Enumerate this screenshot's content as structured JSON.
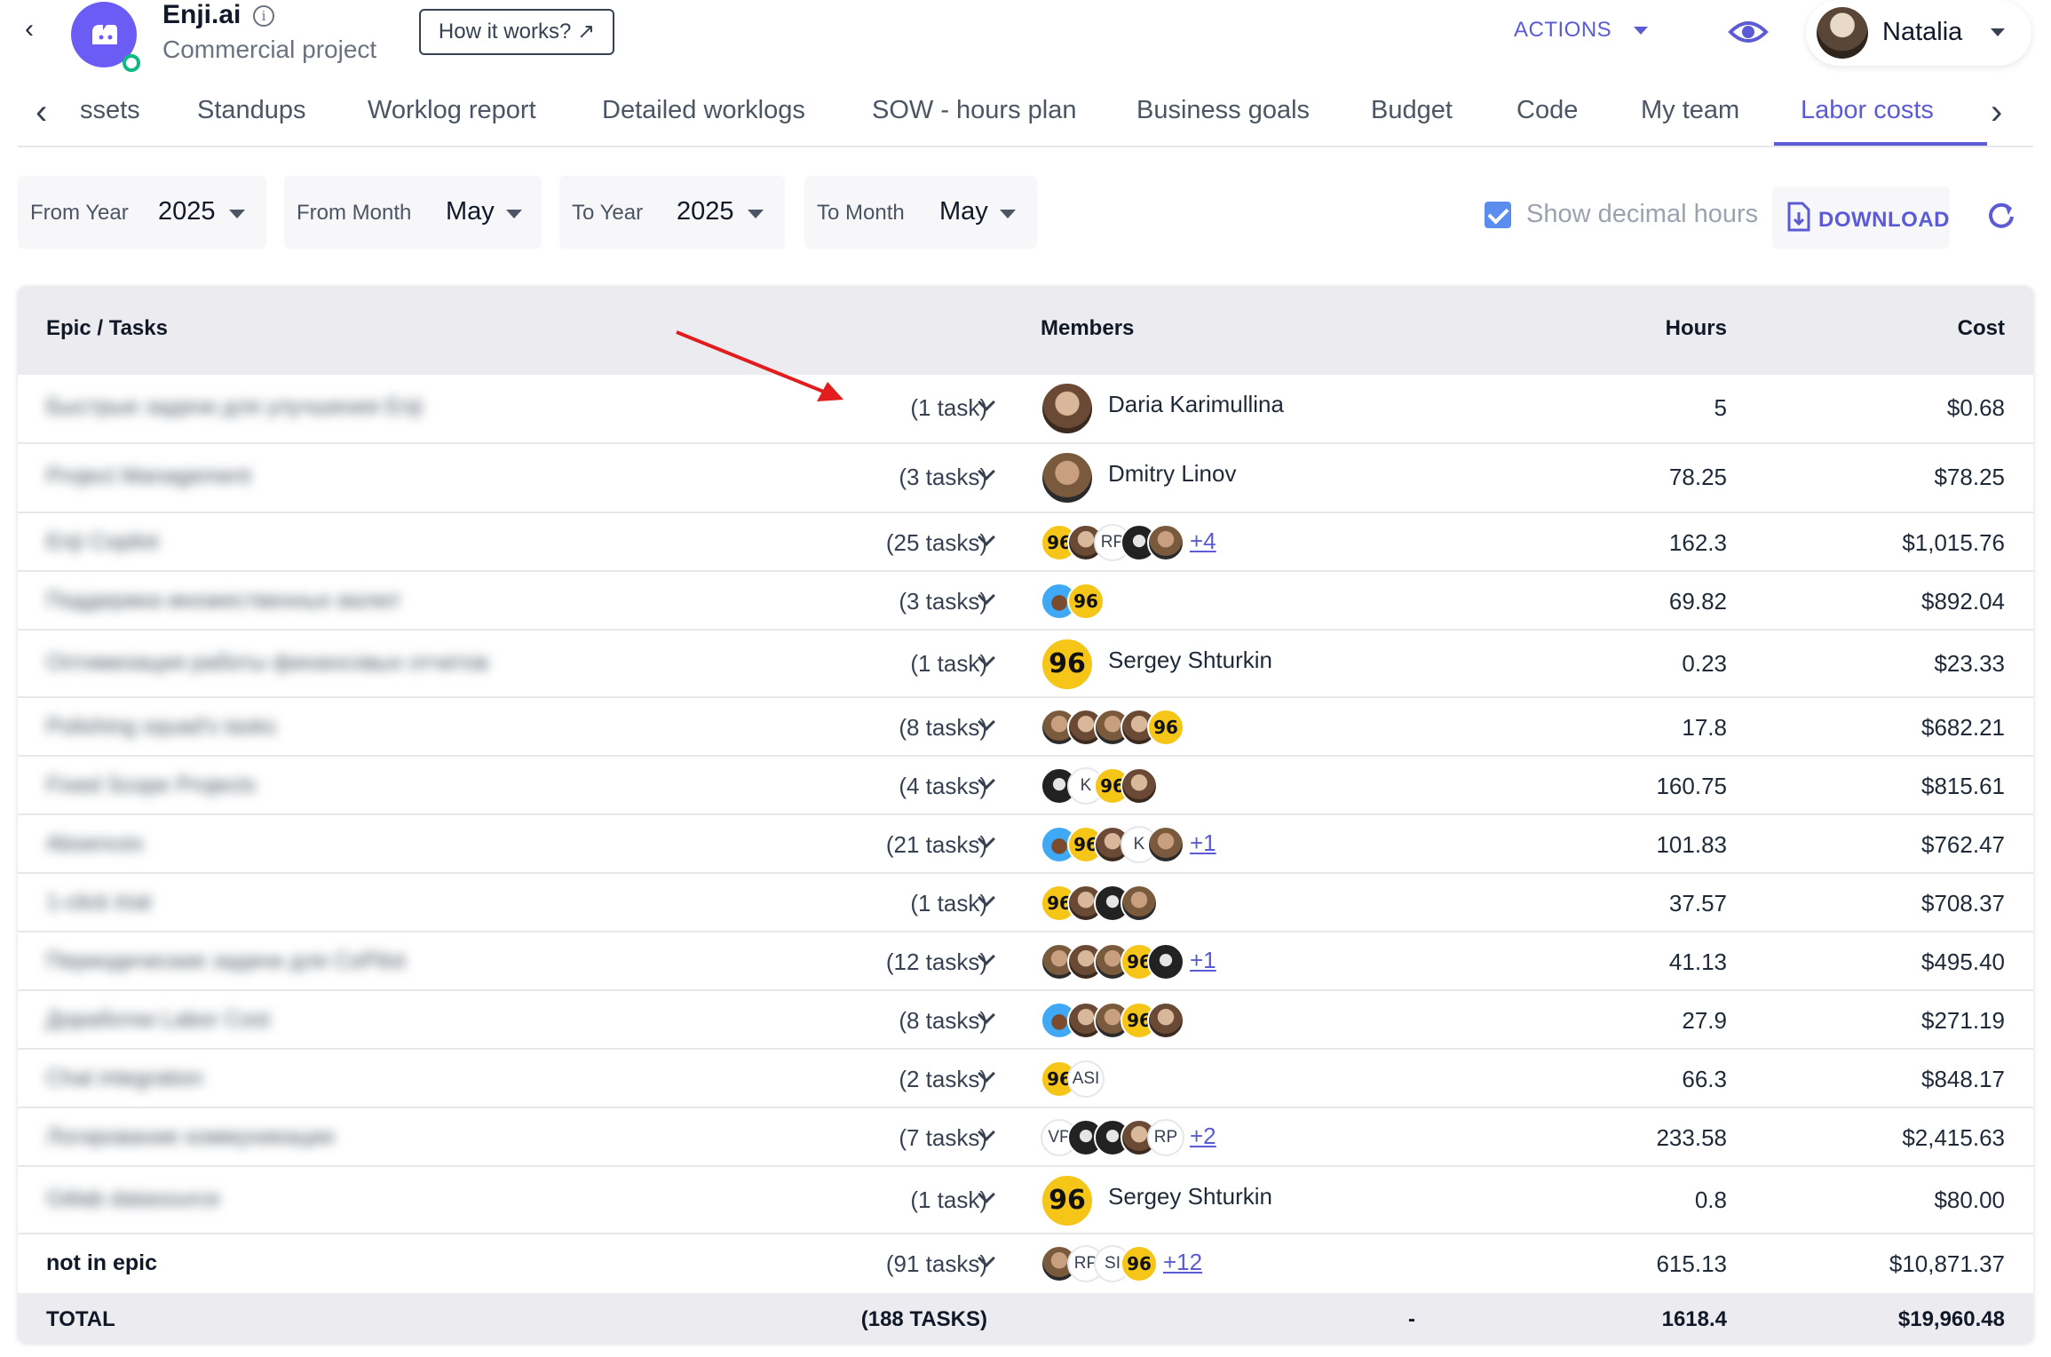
{
  "header": {
    "app_name": "Enji.ai",
    "project_type": "Commercial project",
    "how_it_works": "How it works? ↗",
    "actions": "ACTIONS",
    "user_name": "Natalia"
  },
  "tabs": {
    "items": [
      "ssets",
      "Standups",
      "Worklog report",
      "Detailed worklogs",
      "SOW - hours plan",
      "Business goals",
      "Budget",
      "Code",
      "My team",
      "Labor costs"
    ],
    "active": "Labor costs"
  },
  "filters": {
    "from_year_label": "From Year",
    "from_year": "2025",
    "from_month_label": "From Month",
    "from_month": "May",
    "to_year_label": "To Year",
    "to_year": "2025",
    "to_month_label": "To Month",
    "to_month": "May",
    "decimal_label": "Show decimal hours",
    "download_label": "DOWNLOAD"
  },
  "table": {
    "headers": {
      "epic": "Epic / Tasks",
      "members": "Members",
      "hours": "Hours",
      "cost": "Cost"
    },
    "rows": [
      {
        "epic": "Быстрые задачи для улучшения Enji",
        "tasks": "(1 task)",
        "hours": "5",
        "cost": "$0.68",
        "member_name": "Daria Karimullina"
      },
      {
        "epic": "Project Management",
        "tasks": "(3 tasks)",
        "hours": "78.25",
        "cost": "$78.25",
        "member_name": "Dmitry Linov"
      },
      {
        "epic": "Enji Copilot",
        "tasks": "(25 tasks)",
        "hours": "162.3",
        "cost": "$1,015.76",
        "more": "+4"
      },
      {
        "epic": "Поддержка множественных валют",
        "tasks": "(3 tasks)",
        "hours": "69.82",
        "cost": "$892.04"
      },
      {
        "epic": "Оптимизация работы финансовых отчетов",
        "tasks": "(1 task)",
        "hours": "0.23",
        "cost": "$23.33",
        "member_name": "Sergey Shturkin"
      },
      {
        "epic": "Polishing squad's tasks",
        "tasks": "(8 tasks)",
        "hours": "17.8",
        "cost": "$682.21"
      },
      {
        "epic": "Fixed Scope Projects",
        "tasks": "(4 tasks)",
        "hours": "160.75",
        "cost": "$815.61"
      },
      {
        "epic": "Absences",
        "tasks": "(21 tasks)",
        "hours": "101.83",
        "cost": "$762.47",
        "more": "+1"
      },
      {
        "epic": "1-click trial",
        "tasks": "(1 task)",
        "hours": "37.57",
        "cost": "$708.37"
      },
      {
        "epic": "Периодические задачи для CoPilot",
        "tasks": "(12 tasks)",
        "hours": "41.13",
        "cost": "$495.40",
        "more": "+1"
      },
      {
        "epic": "Доработки Labor Cost",
        "tasks": "(8 tasks)",
        "hours": "27.9",
        "cost": "$271.19"
      },
      {
        "epic": "Chat integration",
        "tasks": "(2 tasks)",
        "hours": "66.3",
        "cost": "$848.17"
      },
      {
        "epic": "Логирование коммуникации",
        "tasks": "(7 tasks)",
        "hours": "233.58",
        "cost": "$2,415.63",
        "more": "+2"
      },
      {
        "epic": "Gitlab datasource",
        "tasks": "(1 task)",
        "hours": "0.8",
        "cost": "$80.00",
        "member_name": "Sergey Shturkin"
      },
      {
        "epic": "not in epic",
        "tasks": "(91 tasks)",
        "hours": "615.13",
        "cost": "$10,871.37",
        "more": "+12"
      }
    ],
    "total": {
      "label": "TOTAL",
      "tasks": "(188 TASKS)",
      "members": "-",
      "hours": "1618.4",
      "cost": "$19,960.48"
    }
  },
  "avatar_texts": {
    "badge": "96",
    "rp": "RP",
    "vp": "VP",
    "k": "K",
    "asi": "ASI",
    "si": "SI"
  },
  "colors": {
    "accent": "#5b5bd6",
    "badge": "#f5c518",
    "arrow": "#e11d1d",
    "online": "#10b981"
  }
}
